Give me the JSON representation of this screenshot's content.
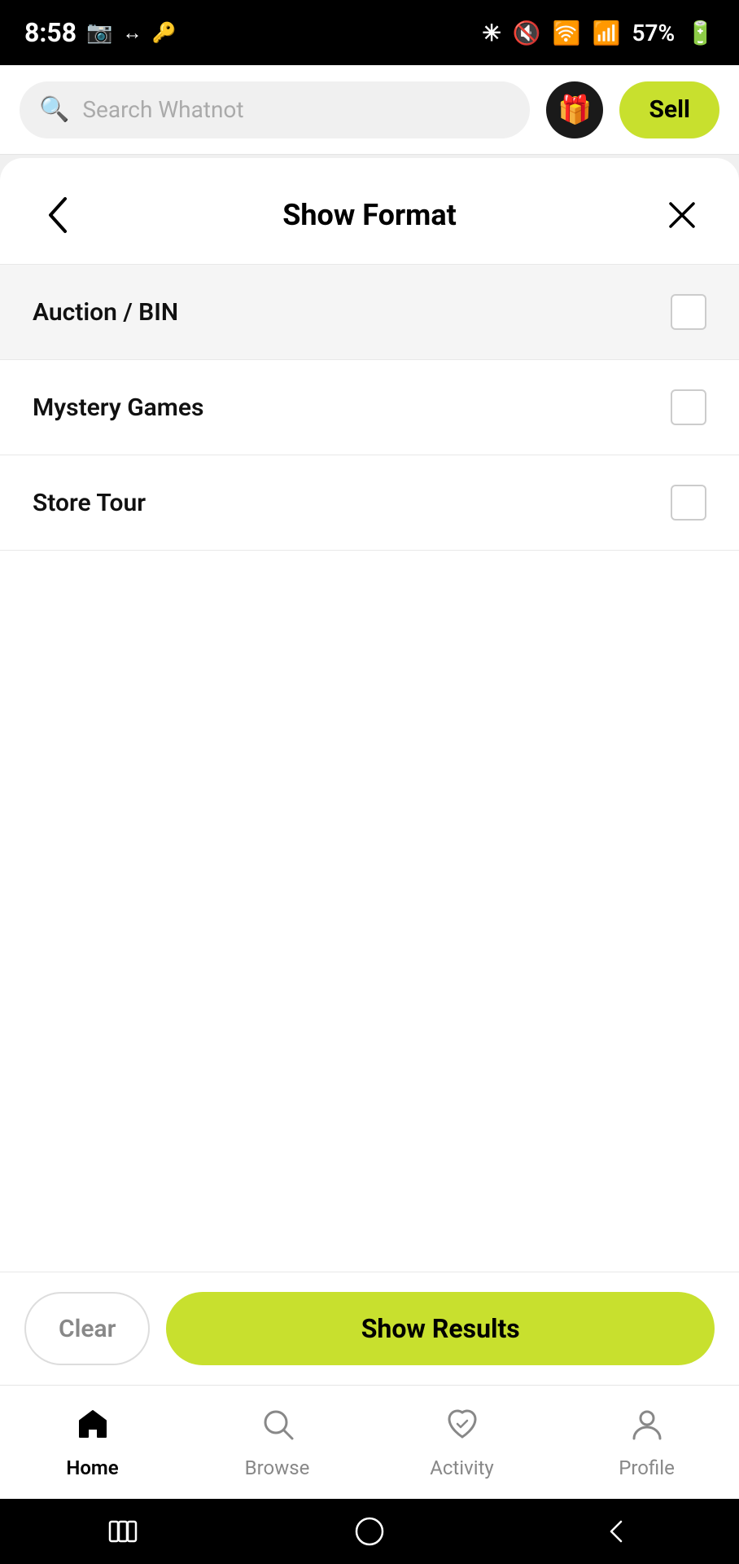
{
  "statusBar": {
    "time": "8:58",
    "icons": {
      "video": "📹",
      "sim": "🔄",
      "key": "🔑",
      "bluetooth": "🔵",
      "mute": "🔇",
      "wifi": "📶",
      "signal": "📶",
      "battery": "57%"
    }
  },
  "topNav": {
    "searchPlaceholder": "Search Whatnot",
    "giftIcon": "🎁",
    "sellLabel": "Sell"
  },
  "modal": {
    "title": "Show Format",
    "backLabel": "‹",
    "closeLabel": "✕",
    "filterItems": [
      {
        "id": "auction-bin",
        "label": "Auction / BIN",
        "checked": false
      },
      {
        "id": "mystery-games",
        "label": "Mystery Games",
        "checked": false
      },
      {
        "id": "store-tour",
        "label": "Store Tour",
        "checked": false
      }
    ]
  },
  "actionBar": {
    "clearLabel": "Clear",
    "showResultsLabel": "Show Results"
  },
  "bottomNav": {
    "items": [
      {
        "id": "home",
        "label": "Home",
        "icon": "🏠",
        "active": true
      },
      {
        "id": "browse",
        "label": "Browse",
        "icon": "🔍",
        "active": false
      },
      {
        "id": "activity",
        "label": "Activity",
        "icon": "💙",
        "active": false
      },
      {
        "id": "profile",
        "label": "Profile",
        "icon": "👤",
        "active": false
      }
    ]
  },
  "androidNav": {
    "recentIcon": "|||",
    "homeIcon": "○",
    "backIcon": "<"
  }
}
